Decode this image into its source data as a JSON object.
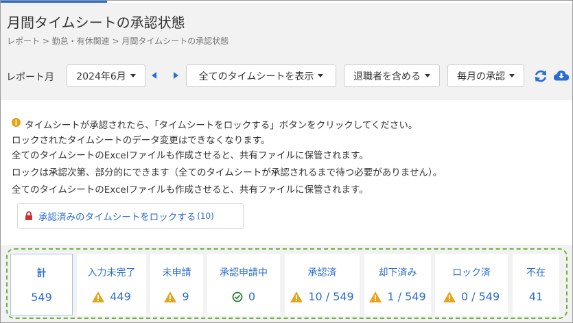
{
  "header": {
    "title": "月間タイムシートの承認状態",
    "breadcrumb": "レポート > 勤怠・有休関連 > 月間タイムシートの承認状態"
  },
  "toolbar": {
    "report_month_label": "レポート月",
    "month_value": "2024年6月",
    "filter_timesheets": "全てのタイムシートを表示",
    "include_retired": "退職者を含める",
    "approval_type": "毎月の承認",
    "prev_icon": "arrow-left-icon",
    "next_icon": "arrow-right-icon",
    "refresh_icon": "refresh-icon",
    "download_icon": "cloud-download-icon"
  },
  "info": {
    "icon": "info-circle-icon",
    "lines": [
      "タイムシートが承認されたら、「タイムシートをロックする」ボタンをクリックしてください。",
      "ロックされたタイムシートのデータ変更はできなくなります。",
      "全てのタイムシートのExcelファイルも作成させると、共有ファイルに保管されます。",
      "ロックは承認次第、部分的にできます（全てのタイムシートが承認されるまで待つ必要がありません）。",
      "全てのタイムシートのExcelファイルも作成させると、共有ファイルに保管されます。"
    ],
    "lock_button_label": "承認済みのタイムシートをロックする",
    "lock_button_count": "(10)"
  },
  "stats": [
    {
      "label": "計",
      "value": "549",
      "icon": "",
      "active": true
    },
    {
      "label": "入力未完了",
      "value": "449",
      "icon": "warning-icon"
    },
    {
      "label": "未申請",
      "value": "9",
      "icon": "warning-icon"
    },
    {
      "label": "承認申請中",
      "value": "0",
      "icon": "check-circle-icon"
    },
    {
      "label": "承認済",
      "value": "10 / 549",
      "icon": "warning-icon"
    },
    {
      "label": "却下済み",
      "value": "1 / 549",
      "icon": "warning-icon"
    },
    {
      "label": "ロック済",
      "value": "0 / 549",
      "icon": "warning-icon"
    },
    {
      "label": "不在",
      "value": "41",
      "icon": ""
    }
  ],
  "colors": {
    "accent": "#2b6cd1",
    "warning": "#e8a317",
    "success": "#2e7d32",
    "danger": "#d32f2f",
    "highlight_border": "#6db33f",
    "panel_bg": "#f2f2f2"
  }
}
